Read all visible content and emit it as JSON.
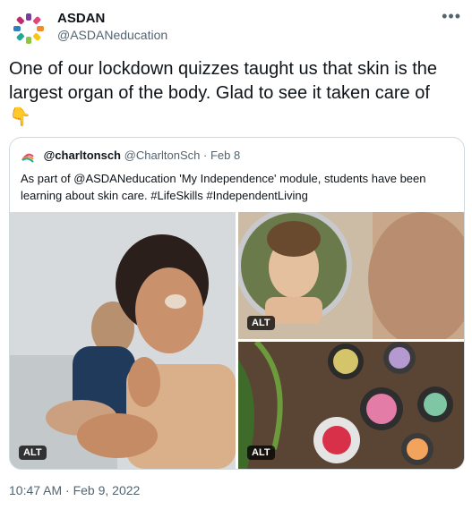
{
  "author": {
    "name": "ASDAN",
    "handle": "@ASDANeducation"
  },
  "more_icon": "more-horizontal-icon",
  "tweet": {
    "text": "One of our lockdown quizzes taught us that skin is the largest organ of the body. Glad to see it taken care of",
    "emoji": "👇"
  },
  "quote": {
    "name": "@charltonsch",
    "handle": "@CharltonSch",
    "separator": "·",
    "date": "Feb 8",
    "text": "As part of @ASDANeducation 'My Independence' module, students have been learning about skin care. #LifeSkills #IndependentLiving",
    "media": [
      {
        "alt_label": "ALT"
      },
      {
        "alt_label": "ALT"
      },
      {
        "alt_label": "ALT"
      }
    ]
  },
  "timestamp": "10:47 AM · Feb 9, 2022"
}
